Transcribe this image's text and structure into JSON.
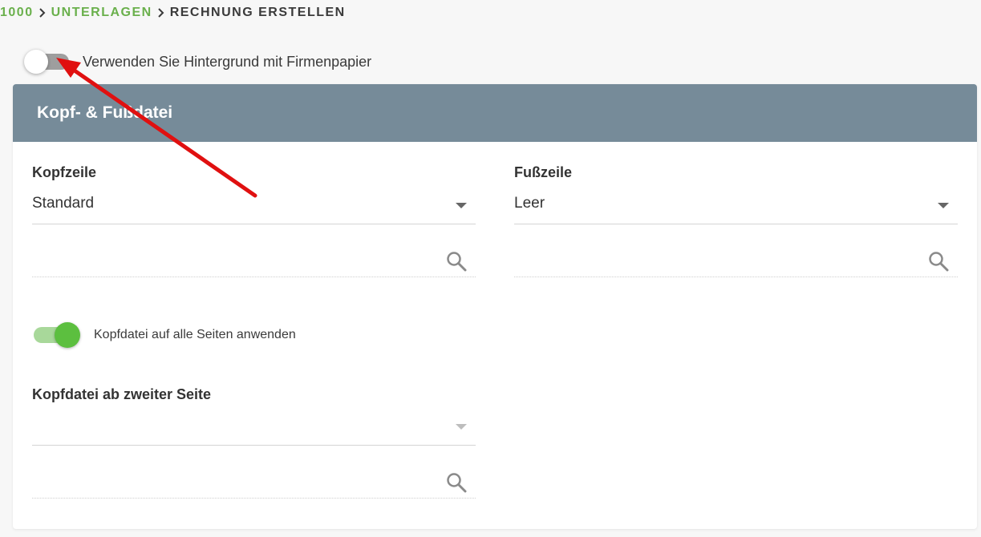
{
  "breadcrumb": {
    "items": [
      "1000",
      "UNTERLAGEN"
    ],
    "current": "RECHNUNG ERSTELLEN"
  },
  "background_toggle": {
    "label": "Verwenden Sie Hintergrund mit Firmenpapier",
    "state": "off"
  },
  "card": {
    "title": "Kopf- & Fußdatei"
  },
  "header_field": {
    "label": "Kopfzeile",
    "selected": "Standard",
    "search_value": ""
  },
  "footer_field": {
    "label": "Fußzeile",
    "selected": "Leer",
    "search_value": ""
  },
  "apply_all_toggle": {
    "label": "Kopfdatei auf alle Seiten anwenden",
    "state": "on"
  },
  "second_page_field": {
    "label": "Kopfdatei ab zweiter Seite",
    "selected": "",
    "search_value": ""
  },
  "colors": {
    "accent_green": "#6ab04c",
    "switch_on": "#5cbf3f",
    "switch_off_track": "#9e9e9e",
    "card_header": "#768b99",
    "annotation_arrow": "#e01010"
  },
  "icons": [
    "chevron-right-icon",
    "search-icon",
    "caret-down-icon"
  ]
}
